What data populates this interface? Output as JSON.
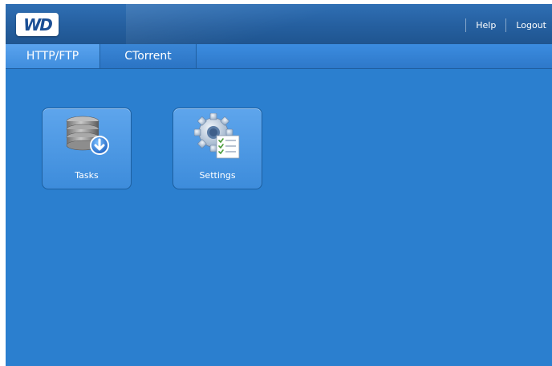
{
  "header": {
    "logo_text": "WD",
    "links": {
      "help": "Help",
      "logout": "Logout"
    }
  },
  "tabs": [
    {
      "label": "HTTP/FTP",
      "active": true
    },
    {
      "label": "CTorrent",
      "active": false
    }
  ],
  "tiles": [
    {
      "label": "Tasks",
      "icon": "database-download-icon"
    },
    {
      "label": "Settings",
      "icon": "settings-gear-icon"
    }
  ],
  "colors": {
    "background": "#2b7fcf",
    "tile": "#4f99e6",
    "header": "#255f9f"
  }
}
